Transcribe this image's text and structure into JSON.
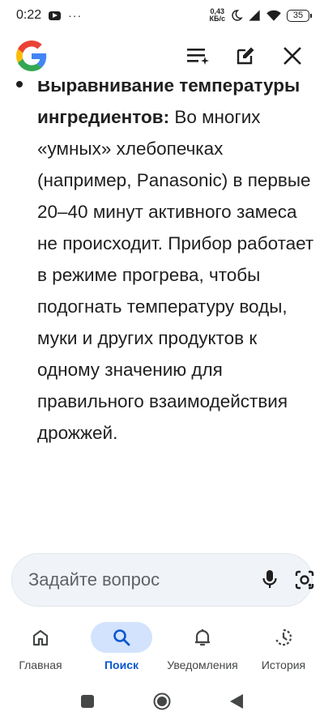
{
  "status_bar": {
    "time": "0:22",
    "more": "···",
    "speed_value": "0,43",
    "speed_unit": "КБ/с",
    "battery": "35"
  },
  "app_bar": {
    "logo": "google-g-logo",
    "icons": [
      "stacked-lines-sparkle-icon",
      "edit-icon",
      "close-icon"
    ]
  },
  "content": {
    "bullet_bold": "Выравнивание температуры ингредиентов:",
    "bullet_text": " Во многих «умных» хлебопечках (например, Panasonic) в первые 20–40 минут активного замеса не происходит. Прибор работает в режиме прогрева, чтобы подогнать температуру воды, муки и других продуктов к одному значению для правильного взаимодействия дрожжей."
  },
  "ask_bar": {
    "placeholder": "Задайте вопрос",
    "icons": [
      "microphone-icon",
      "lens-camera-icon"
    ]
  },
  "bottom_nav": {
    "items": [
      {
        "label": "Главная",
        "icon": "home-icon",
        "active": false
      },
      {
        "label": "Поиск",
        "icon": "search-icon",
        "active": true
      },
      {
        "label": "Уведомления",
        "icon": "bell-icon",
        "active": false
      },
      {
        "label": "История",
        "icon": "history-icon",
        "active": false
      }
    ]
  },
  "system_nav": [
    "square-icon",
    "circle-icon",
    "back-triangle-icon"
  ],
  "colors": {
    "accent": "#0b57d0",
    "active_pill": "#d3e3fd",
    "ask_bar_bg": "#f0f4f9",
    "text": "#1f1f1f",
    "g_blue": "#4285F4",
    "g_red": "#EA4335",
    "g_yellow": "#FBBC05",
    "g_green": "#34A853"
  }
}
